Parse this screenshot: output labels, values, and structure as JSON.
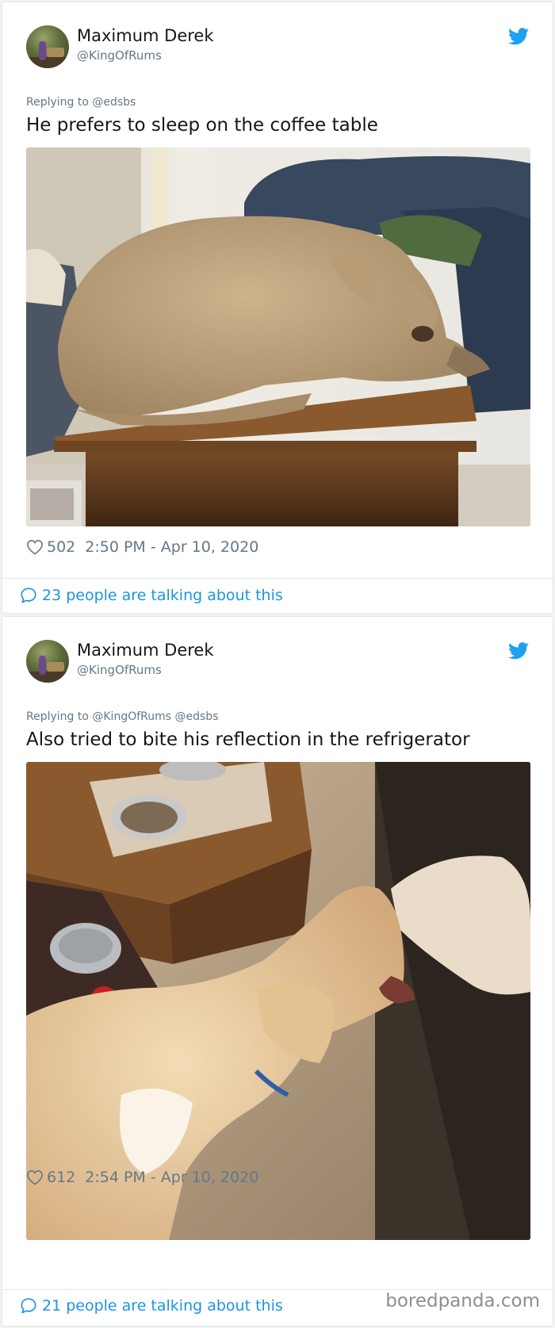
{
  "colors": {
    "twitter_blue": "#1da1f2",
    "link_blue": "#1b95e0",
    "secondary_text": "#657786",
    "primary_text": "#14171a",
    "border": "#e1e8ed"
  },
  "tweets": [
    {
      "display_name": "Maximum Derek",
      "handle": "@KingOfRums",
      "replying_to": "Replying to @edsbs",
      "text": "He prefers to sleep on the coffee table",
      "media_icon": "photo-dog-sleeping-on-table",
      "likes": "502",
      "timestamp": "2:50 PM - Apr 10, 2020",
      "talking": "23 people are talking about this"
    },
    {
      "display_name": "Maximum Derek",
      "handle": "@KingOfRums",
      "replying_to": "Replying to @KingOfRums @edsbs",
      "text": "Also tried to bite his reflection in the refrigerator",
      "media_icon": "photo-dog-biting-reflection",
      "likes": "612",
      "timestamp": "2:54 PM - Apr 10, 2020",
      "talking": "21 people are talking about this"
    }
  ],
  "watermark": "boredpanda.com"
}
